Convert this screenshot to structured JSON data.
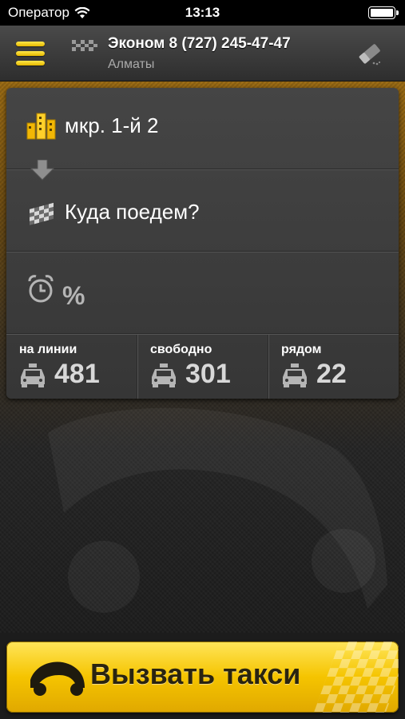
{
  "status_bar": {
    "carrier": "Оператор",
    "time": "13:13",
    "icons": [
      "wifi-icon",
      "battery-icon"
    ]
  },
  "header": {
    "title": "Эконом 8 (727) 245-47-47",
    "subtitle": "Алматы",
    "icons": [
      "menu-icon",
      "checker-icon",
      "eraser-icon"
    ]
  },
  "order": {
    "from_address": "мкр. 1-й 2",
    "to_placeholder": "Куда поедем?",
    "time_percent": "%",
    "icons": [
      "buildings-icon",
      "arrow-down-icon",
      "finish-flag-icon",
      "alarm-clock-icon"
    ]
  },
  "stats": [
    {
      "label": "на линии",
      "value": "481",
      "icon": "taxi-icon"
    },
    {
      "label": "свободно",
      "value": "301",
      "icon": "taxi-icon"
    },
    {
      "label": "рядом",
      "value": "22",
      "icon": "taxi-icon"
    }
  ],
  "call_button": {
    "label": "Вызвать такси",
    "icon": "car-icon"
  },
  "colors": {
    "accent_yellow": "#f5c400",
    "card_bg": "#3a3a3a",
    "header_bg": "#3a3a3a"
  }
}
